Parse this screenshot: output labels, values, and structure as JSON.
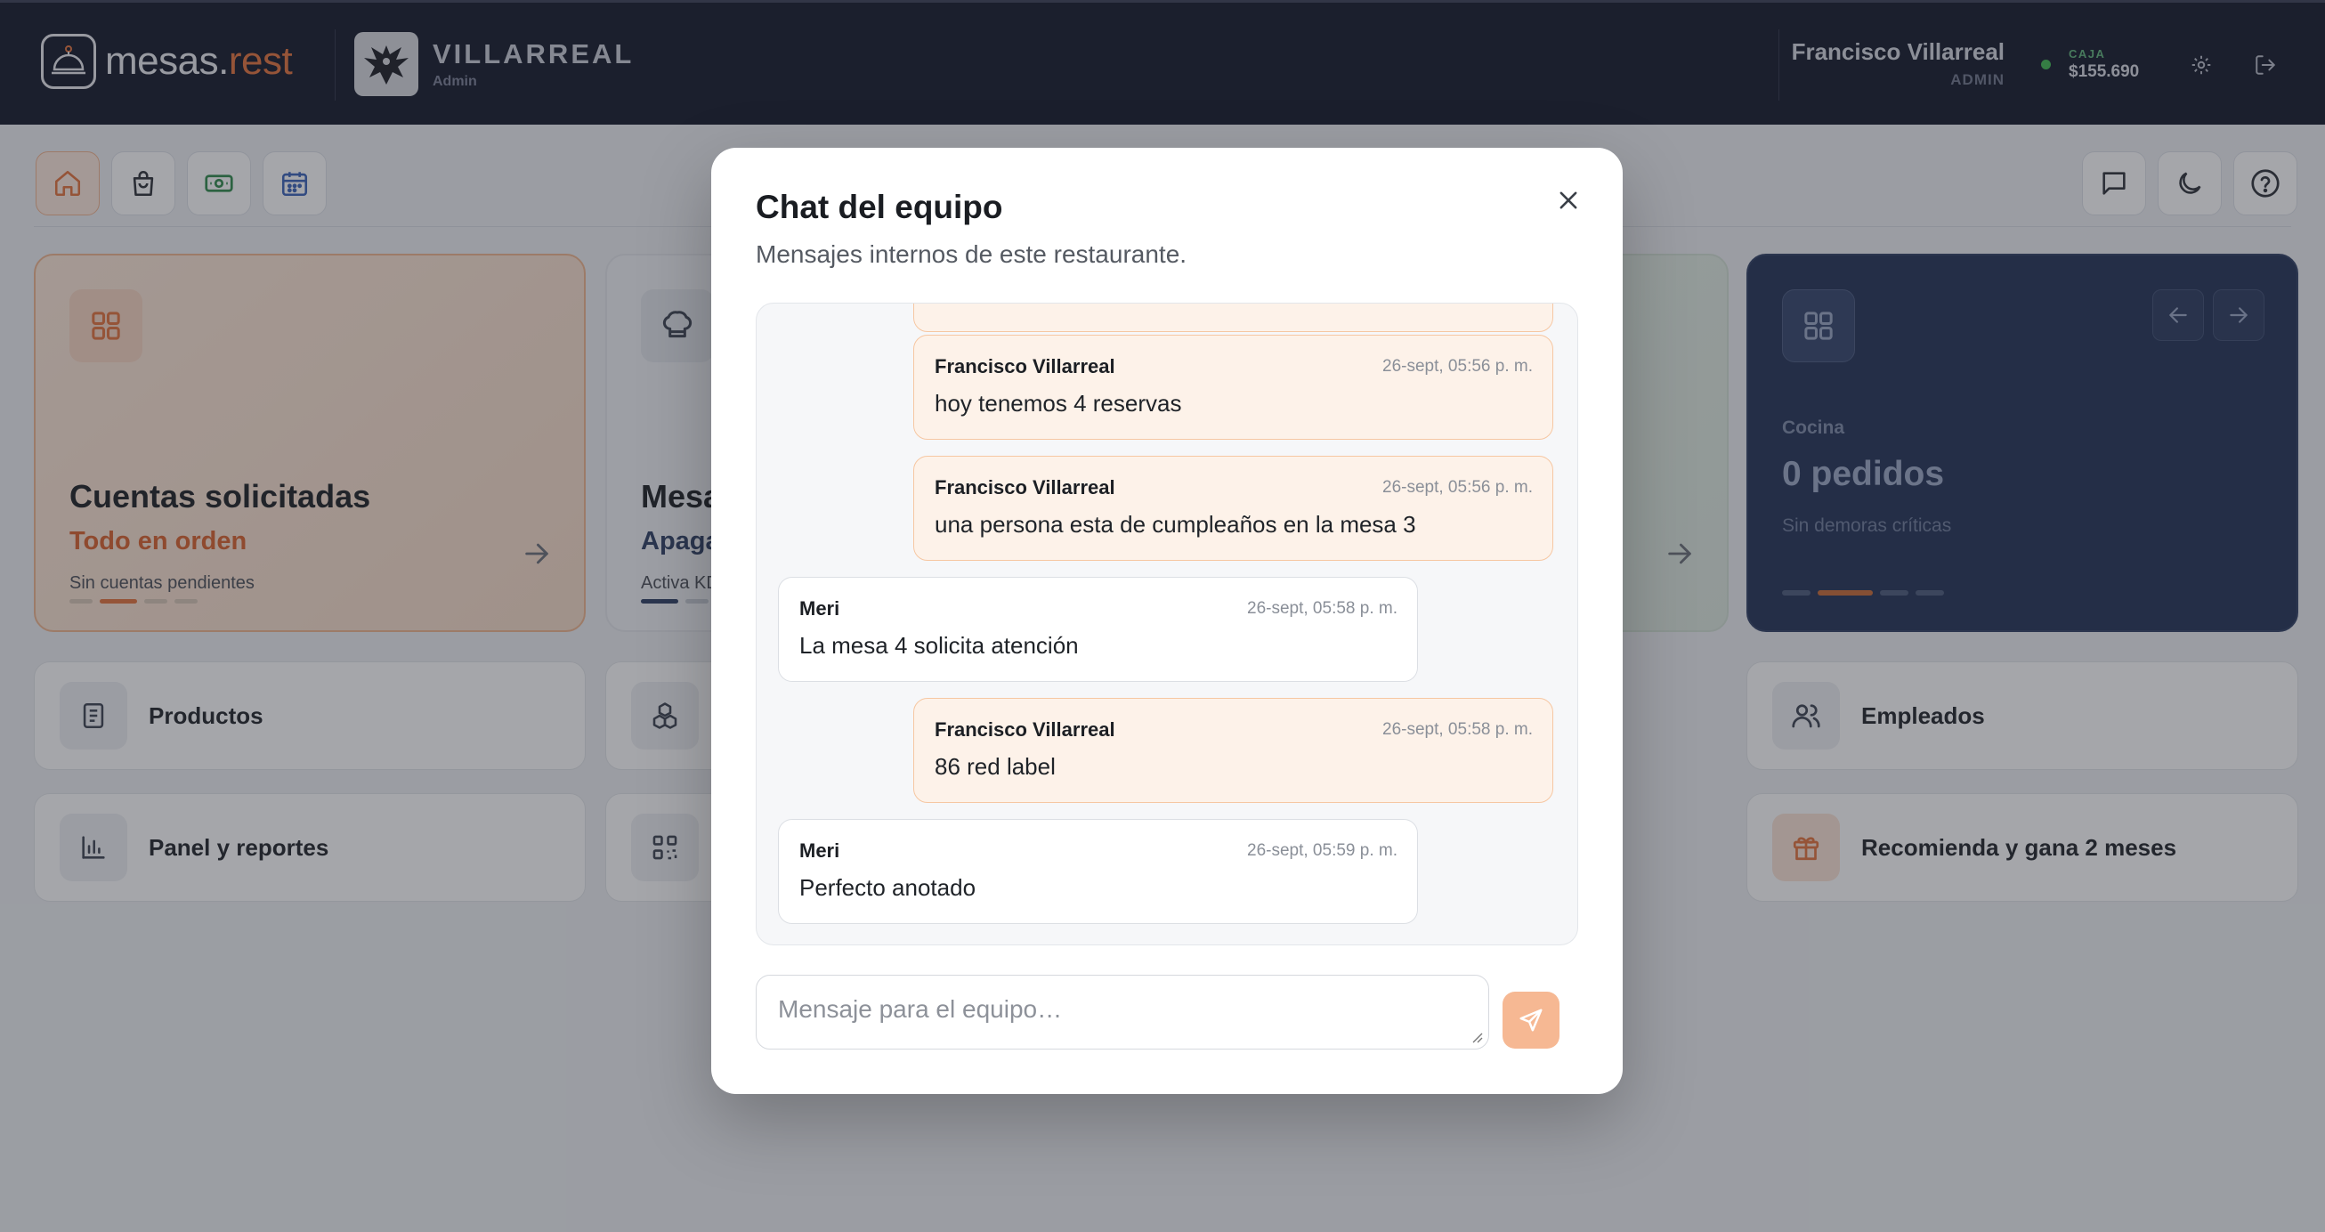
{
  "header": {
    "logo": {
      "text_main": "mesas.",
      "text_accent": "rest"
    },
    "brand": {
      "name": "VILLARREAL",
      "role": "Admin"
    },
    "user": {
      "name": "Francisco Villarreal",
      "role": "ADMIN"
    },
    "caja": {
      "label": "CAJA",
      "value": "$155.690"
    },
    "icons": [
      "settings-icon",
      "logout-icon"
    ]
  },
  "toolbar": {
    "left_icons": [
      "home-icon",
      "shopping-bag-icon",
      "cash-icon",
      "calendar-icon"
    ],
    "right_icons": [
      "chat-icon",
      "moon-icon",
      "help-icon"
    ]
  },
  "cards": {
    "cuentas": {
      "title": "Cuentas solicitadas",
      "status": "Todo en orden",
      "detail": "Sin cuentas pendientes"
    },
    "mesas": {
      "title": "Mesa",
      "status": "Apaga",
      "detail": "Activa KD"
    },
    "cocina": {
      "label": "Cocina",
      "value": "0 pedidos",
      "detail": "Sin demoras críticas"
    }
  },
  "tiles": {
    "productos": "Productos",
    "empleados": "Empleados",
    "panel": "Panel y reportes",
    "recomienda": "Recomienda y gana 2 meses"
  },
  "modal": {
    "title": "Chat del equipo",
    "subtitle": "Mensajes internos de este restaurante.",
    "messages": [
      {
        "author": "Francisco Villarreal",
        "time": "26-sept, 05:56 p. m.",
        "text": "hoy tenemos 4 reservas",
        "mine": true
      },
      {
        "author": "Francisco Villarreal",
        "time": "26-sept, 05:56 p. m.",
        "text": "una persona esta de cumpleaños en la mesa 3",
        "mine": true
      },
      {
        "author": "Meri",
        "time": "26-sept, 05:58 p. m.",
        "text": "La mesa 4 solicita atención",
        "mine": false
      },
      {
        "author": "Francisco Villarreal",
        "time": "26-sept, 05:58 p. m.",
        "text": "86 red label",
        "mine": true
      },
      {
        "author": "Meri",
        "time": "26-sept, 05:59 p. m.",
        "text": "Perfecto anotado",
        "mine": false
      }
    ],
    "input_placeholder": "Mensaje para el equipo…",
    "input_value": ""
  },
  "colors": {
    "topbar": "#121829",
    "accent": "#e4723c",
    "dark_card": "#213155",
    "online": "#3fb950"
  }
}
